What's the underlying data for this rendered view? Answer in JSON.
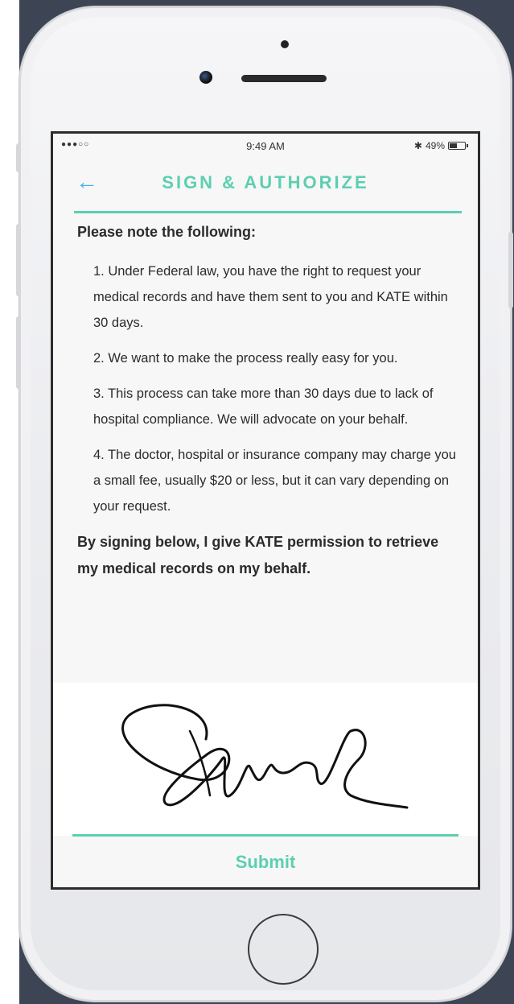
{
  "status_bar": {
    "signal": "●●●○○",
    "time": "9:49 AM",
    "bluetooth": "✱",
    "battery_percent": "49%",
    "battery_level": 0.49
  },
  "header": {
    "back_icon": "arrow-left-icon",
    "title": "SIGN & AUTHORIZE"
  },
  "content": {
    "intro": "Please note the following:",
    "items": [
      "1. Under Federal law, you have the right to request your medical records and have them sent to you and KATE within 30 days.",
      "2. We want to make the process really easy for you.",
      "3. This process can take more than 30 days due to lack of hospital compliance. We will advocate on your behalf.",
      "4. The doctor, hospital or insurance company may charge you a small fee, usually $20 or less, but it can vary depending on your request."
    ],
    "consent": "By signing below, I give KATE permission to retrieve my medical records on my behalf."
  },
  "footer": {
    "submit_label": "Submit"
  },
  "colors": {
    "accent": "#5ccfb0",
    "back_arrow": "#41b6e6",
    "text": "#2b2b2b"
  }
}
